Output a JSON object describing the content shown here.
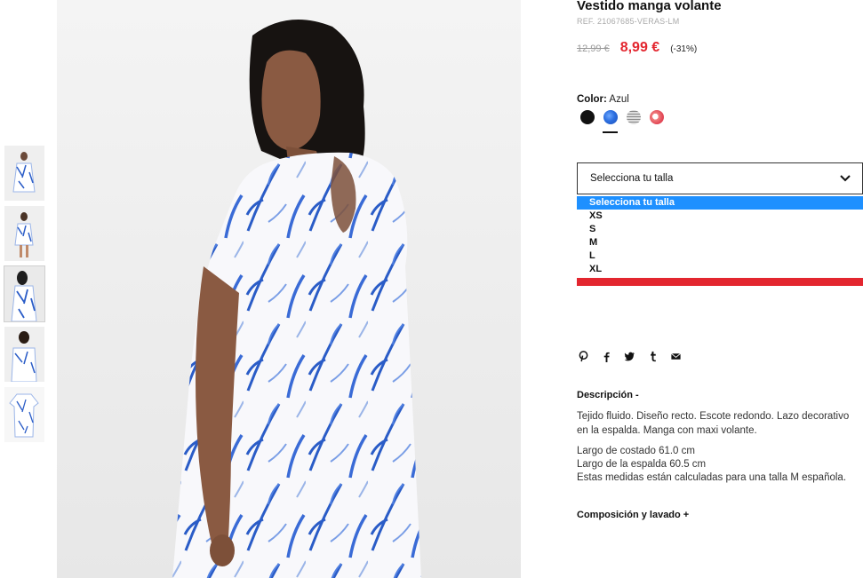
{
  "product": {
    "title": "Vestido manga volante",
    "ref": "REF. 21067685-VERAS-LM",
    "price_old": "12,99 €",
    "price_new": "8,99 €",
    "discount": "(-31%)"
  },
  "color": {
    "label": "Color:",
    "value": "Azul",
    "swatches": [
      "black",
      "blue-print",
      "striped",
      "pink-print"
    ],
    "selected": "blue-print"
  },
  "size": {
    "select_label": "Selecciona tu talla",
    "options": [
      "Selecciona tu talla",
      "XS",
      "S",
      "M",
      "L",
      "XL"
    ],
    "highlighted": "Selecciona tu talla"
  },
  "social": [
    "pinterest-icon",
    "facebook-icon",
    "twitter-icon",
    "tumblr-icon",
    "email-icon"
  ],
  "description": {
    "heading": "Descripción -",
    "text": "Tejido fluido. Diseño recto. Escote redondo. Lazo decorativo en la espalda. Manga con maxi volante.",
    "measures": [
      "Largo de costado 61.0 cm",
      "Largo de la espalda 60.5 cm",
      "Estas medidas están calculadas para una talla M española."
    ]
  },
  "composition": {
    "heading": "Composición y lavado +"
  },
  "colors": {
    "accent_red": "#e3262f",
    "highlight_blue": "#1e90ff",
    "print_blue": "#2a5cc7"
  }
}
